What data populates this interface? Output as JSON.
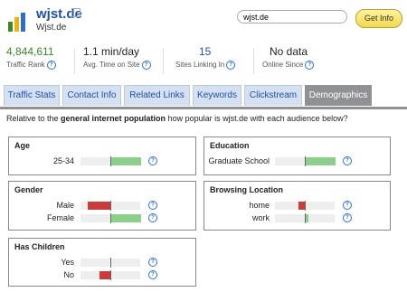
{
  "header": {
    "site_name": "wjst.de",
    "site_sub": "Wjst.de",
    "search_value": "wjst.de",
    "get_info_label": "Get Info"
  },
  "stats": [
    {
      "value": "4,844,611",
      "label": "Traffic Rank"
    },
    {
      "value": "1.1 min/day",
      "label": "Avg. Time on Site"
    },
    {
      "value": "15",
      "label": "Sites Linking In"
    },
    {
      "value": "No data",
      "label": "Online Since"
    }
  ],
  "tabs": [
    {
      "label": "Traffic Stats"
    },
    {
      "label": "Contact Info"
    },
    {
      "label": "Related Links"
    },
    {
      "label": "Keywords"
    },
    {
      "label": "Clickstream"
    },
    {
      "label": "Demographics",
      "active": true
    }
  ],
  "intro": {
    "pre": "Relative to the ",
    "bold": "general internet population",
    "post": " how popular is wjst.de with each audience below?"
  },
  "panels": {
    "age": {
      "title": "Age",
      "rows": [
        {
          "label": "25-34",
          "value": 1.0
        }
      ]
    },
    "education": {
      "title": "Education",
      "rows": [
        {
          "label": "Graduate School",
          "value": 1.0
        }
      ]
    },
    "gender": {
      "title": "Gender",
      "rows": [
        {
          "label": "Male",
          "value": -0.75
        },
        {
          "label": "Female",
          "value": 1.0
        }
      ]
    },
    "browsing": {
      "title": "Browsing Location",
      "rows": [
        {
          "label": "home",
          "value": -0.2
        },
        {
          "label": "work",
          "value": 0.08
        }
      ]
    },
    "children": {
      "title": "Has Children",
      "rows": [
        {
          "label": "Yes",
          "value": 0.0
        },
        {
          "label": "No",
          "value": -0.35
        }
      ]
    }
  },
  "help_glyph": "?",
  "colors": {
    "positive": "#8ccf8a",
    "negative": "#cc3b3b",
    "link": "#1f4fa5",
    "tab_active": "#8f9195"
  }
}
